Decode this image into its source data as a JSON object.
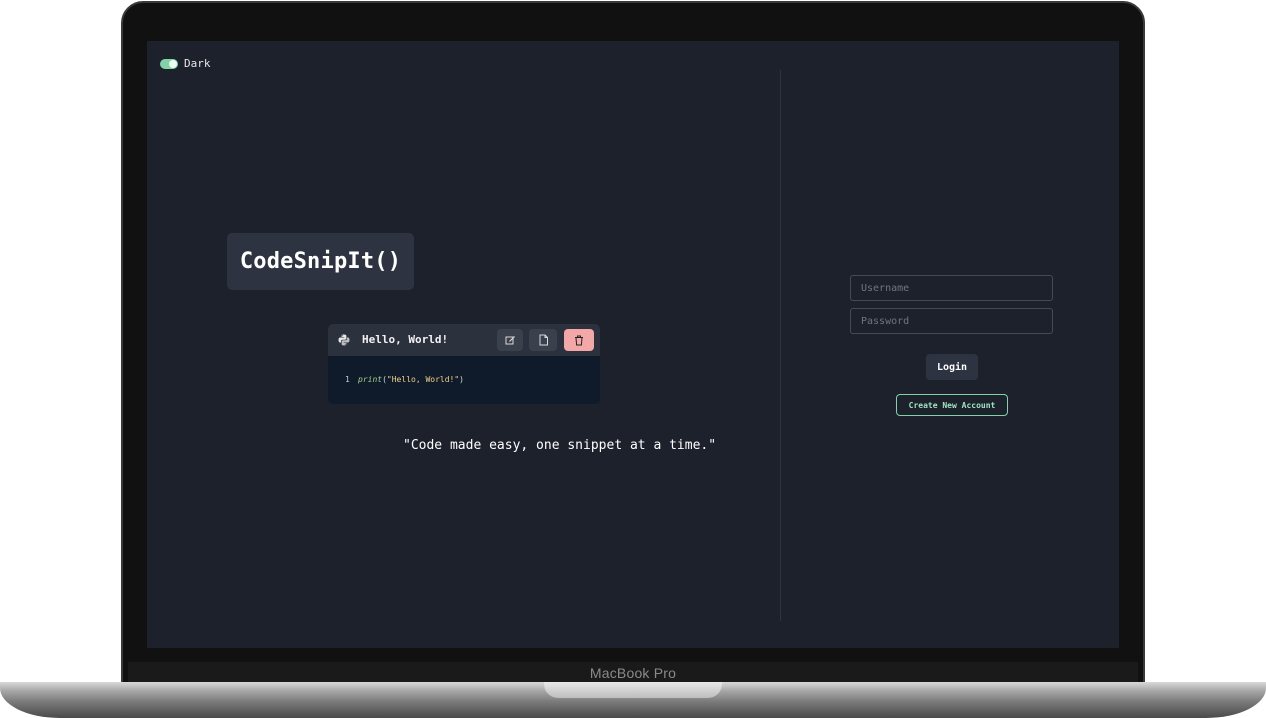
{
  "device": {
    "brand_label": "MacBook Pro"
  },
  "theme_toggle": {
    "label": "Dark",
    "enabled": true
  },
  "logo": {
    "text": "CodeSnipIt()"
  },
  "snippet": {
    "language_icon": "python-icon",
    "title": "Hello, World!",
    "actions": [
      "edit-icon",
      "copy-icon",
      "trash-icon"
    ],
    "code": {
      "line_number": "1",
      "function": "print",
      "open": "(",
      "string": "\"Hello, World!\"",
      "close": ")"
    }
  },
  "tagline": "\"Code made easy, one snippet at a time.\"",
  "login_form": {
    "username_placeholder": "Username",
    "password_placeholder": "Password",
    "login_label": "Login",
    "create_account_label": "Create New Account"
  },
  "colors": {
    "background": "#1c212b",
    "accent_green": "#7fd3a6",
    "delete_red": "#f4a7a7",
    "surface": "#2d3340"
  }
}
